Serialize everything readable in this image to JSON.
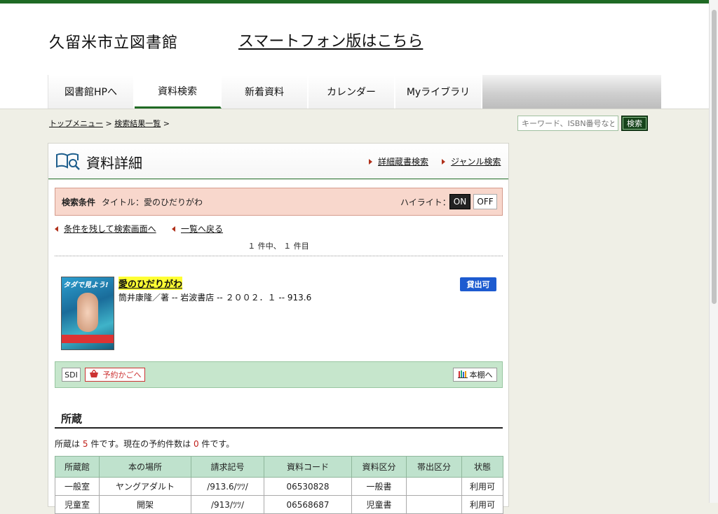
{
  "header": {
    "site_title": "久留米市立図書館",
    "smartphone_link": "スマートフォン版はこちら"
  },
  "nav": {
    "tabs": [
      "図書館HPへ",
      "資料検索",
      "新着資料",
      "カレンダー",
      "Myライブラリ"
    ],
    "active_index": 1
  },
  "breadcrumb": {
    "top_menu": "トップメニュー",
    "search_results": "検索結果一覧",
    "sep": ">"
  },
  "search": {
    "placeholder": "キーワード、ISBN番号など",
    "button": "検索"
  },
  "panel": {
    "title": "資料詳細",
    "advanced_search": "詳細蔵書検索",
    "genre_search": "ジャンル検索"
  },
  "conditions": {
    "label": "検索条件",
    "text": "タイトル：愛のひだりがわ",
    "highlight_label": "ハイライト：",
    "on": "ON",
    "off": "OFF"
  },
  "links": {
    "keep_conditions": "条件を残して検索画面へ",
    "back_to_list": "一覧へ戻る"
  },
  "result_count": "１ 件中、 １ 件目",
  "book": {
    "title": "愛のひだりがわ",
    "meta": "筒井康隆／著 -- 岩波書店 -- ２００２．１ -- 913.6",
    "availability": "貸出可",
    "cover_text": "タダで見よう!"
  },
  "actions": {
    "sdi": "SDI",
    "reserve_cart": "予約かごへ",
    "bookshelf": "本棚へ"
  },
  "holdings": {
    "section_title": "所蔵",
    "summary_prefix": "所蔵は",
    "holdings_count": "5",
    "summary_mid": "件です。現在の予約件数は",
    "reserve_count": "0",
    "summary_suffix": "件です。",
    "columns": [
      "所蔵館",
      "本の場所",
      "請求記号",
      "資料コード",
      "資料区分",
      "帯出区分",
      "状態"
    ],
    "rows": [
      [
        "一般室",
        "ヤングアダルト",
        "/913.6/ﾂﾂ/",
        "06530828",
        "一般書",
        "",
        "利用可"
      ],
      [
        "児童室",
        "開架",
        "/913/ﾂﾂ/",
        "06568687",
        "児童書",
        "",
        "利用可"
      ]
    ]
  },
  "colors": {
    "brand_green": "#1f6a24",
    "condition_bg": "#f8d7cc",
    "action_bg": "#c6e6cc",
    "available_blue": "#1d5bd0"
  }
}
